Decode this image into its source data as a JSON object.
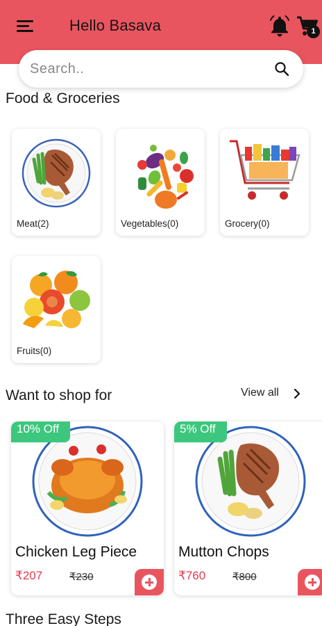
{
  "header": {
    "greeting": "Hello Basava",
    "cart_count": "1",
    "background_color": "#e9555f"
  },
  "search": {
    "placeholder": "Search.."
  },
  "categories": {
    "title": "Food & Groceries",
    "items": [
      {
        "label": "Meat(2)",
        "icon": "meat-plate-icon"
      },
      {
        "label": "Vegetables(0)",
        "icon": "vegetables-icon"
      },
      {
        "label": "Grocery(0)",
        "icon": "shopping-cart-icon"
      },
      {
        "label": "Fruits(0)",
        "icon": "fruits-icon"
      }
    ]
  },
  "shop": {
    "title": "Want to shop for",
    "view_all": "View all",
    "products": [
      {
        "discount": "10% Off",
        "name": "Chicken Leg Piece",
        "price": "₹207",
        "mrp": "₹230",
        "icon": "roast-chicken-icon"
      },
      {
        "discount": "5% Off",
        "name": "Mutton Chops",
        "price": "₹760",
        "mrp": "₹800",
        "icon": "meat-plate-icon"
      }
    ]
  },
  "steps": {
    "title": "Three Easy Steps"
  },
  "colors": {
    "accent": "#e9555f",
    "discount": "#3cc77d",
    "price": "#e23a4a"
  }
}
